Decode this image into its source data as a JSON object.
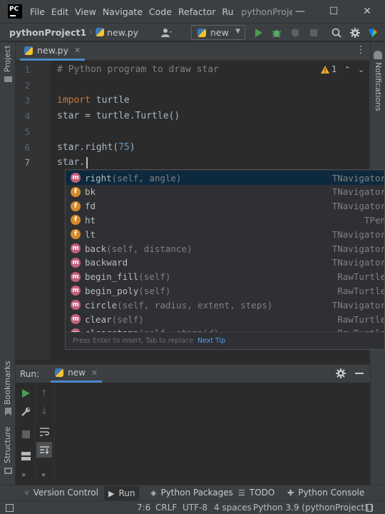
{
  "app": {
    "logo_text": "PC",
    "window_title": "pythonProjec"
  },
  "menu": [
    "File",
    "Edit",
    "View",
    "Navigate",
    "Code",
    "Refactor",
    "Ru"
  ],
  "window_controls": {
    "minimize": "—",
    "maximize": "☐",
    "close": "✕"
  },
  "navbar": {
    "project": "pythonProject1",
    "file": "new.py",
    "run_config": "new"
  },
  "toolbar_icons": [
    "user-icon",
    "run-icon",
    "debug-icon",
    "coverage-icon",
    "stop-icon",
    "search-icon",
    "settings-icon",
    "jetbrains-icon"
  ],
  "left_strip": {
    "project": "Project",
    "bookmarks": "Bookmarks",
    "structure": "Structure"
  },
  "right_strip": {
    "notifications": "Notifications"
  },
  "editor": {
    "tab": "new.py",
    "inspection": {
      "count": "1",
      "level": "warning"
    },
    "line_numbers": [
      "1",
      "2",
      "3",
      "4",
      "5",
      "6",
      "7"
    ],
    "lines": [
      {
        "line": "1",
        "parts": [
          {
            "t": "# Python program to draw star",
            "c": "cmt"
          }
        ]
      },
      {
        "line": "2",
        "parts": []
      },
      {
        "line": "3",
        "parts": [
          {
            "t": "import",
            "c": "kw"
          },
          {
            "t": " turtle",
            "c": ""
          }
        ]
      },
      {
        "line": "4",
        "parts": [
          {
            "t": "star = turtle.Turtle()",
            "c": ""
          }
        ]
      },
      {
        "line": "5",
        "parts": []
      },
      {
        "line": "6",
        "parts": [
          {
            "t": "star.right(",
            "c": ""
          },
          {
            "t": "75",
            "c": "num"
          },
          {
            "t": ")",
            "c": ""
          }
        ]
      },
      {
        "line": "7",
        "parts": [
          {
            "t": "star.",
            "c": ""
          }
        ]
      }
    ]
  },
  "completion": {
    "items": [
      {
        "kind": "m",
        "name": "right",
        "params": "(self, angle)",
        "type": "TNavigator",
        "selected": true
      },
      {
        "kind": "f",
        "name": "bk",
        "params": "",
        "type": "TNavigator"
      },
      {
        "kind": "f",
        "name": "fd",
        "params": "",
        "type": "TNavigator"
      },
      {
        "kind": "f",
        "name": "ht",
        "params": "",
        "type": "TPen"
      },
      {
        "kind": "f",
        "name": "lt",
        "params": "",
        "type": "TNavigator"
      },
      {
        "kind": "m",
        "name": "back",
        "params": "(self, distance)",
        "type": "TNavigator"
      },
      {
        "kind": "m",
        "name": "backward",
        "params": "",
        "type": "TNavigator"
      },
      {
        "kind": "m",
        "name": "begin_fill",
        "params": "(self)",
        "type": "RawTurtle"
      },
      {
        "kind": "m",
        "name": "begin_poly",
        "params": "(self)",
        "type": "RawTurtle"
      },
      {
        "kind": "m",
        "name": "circle",
        "params": "(self, radius, extent, steps)",
        "type": "TNavigator"
      },
      {
        "kind": "m",
        "name": "clear",
        "params": "(self)",
        "type": "RawTurtle"
      },
      {
        "kind": "m",
        "name": "clearstamp",
        "params": "(self, stampid)",
        "type": "RawTurtle"
      }
    ],
    "hint": "Press Enter to insert, Tab to replace",
    "hint_link": "Next Tip"
  },
  "run_panel": {
    "label": "Run:",
    "tab": "new"
  },
  "tool_windows": [
    {
      "id": "version-control",
      "label": "Version Control",
      "icon": "⑂"
    },
    {
      "id": "run",
      "label": "Run",
      "icon": "▶"
    },
    {
      "id": "python-packages",
      "label": "Python Packages",
      "icon": "◈"
    },
    {
      "id": "todo",
      "label": "TODO",
      "icon": "☰"
    },
    {
      "id": "python-console",
      "label": "Python Console",
      "icon": "✚"
    }
  ],
  "status": {
    "position": "7:6",
    "line_sep": "CRLF",
    "encoding": "UTF-8",
    "indent": "4 spaces",
    "interpreter": "Python 3.9 (pythonProject1)"
  },
  "colors": {
    "accent": "#4a88c7",
    "run_green": "#499c54",
    "debug_green": "#59a869",
    "warning": "#f0a732",
    "method_badge": "#c0607a",
    "field_badge": "#d48a2c"
  }
}
